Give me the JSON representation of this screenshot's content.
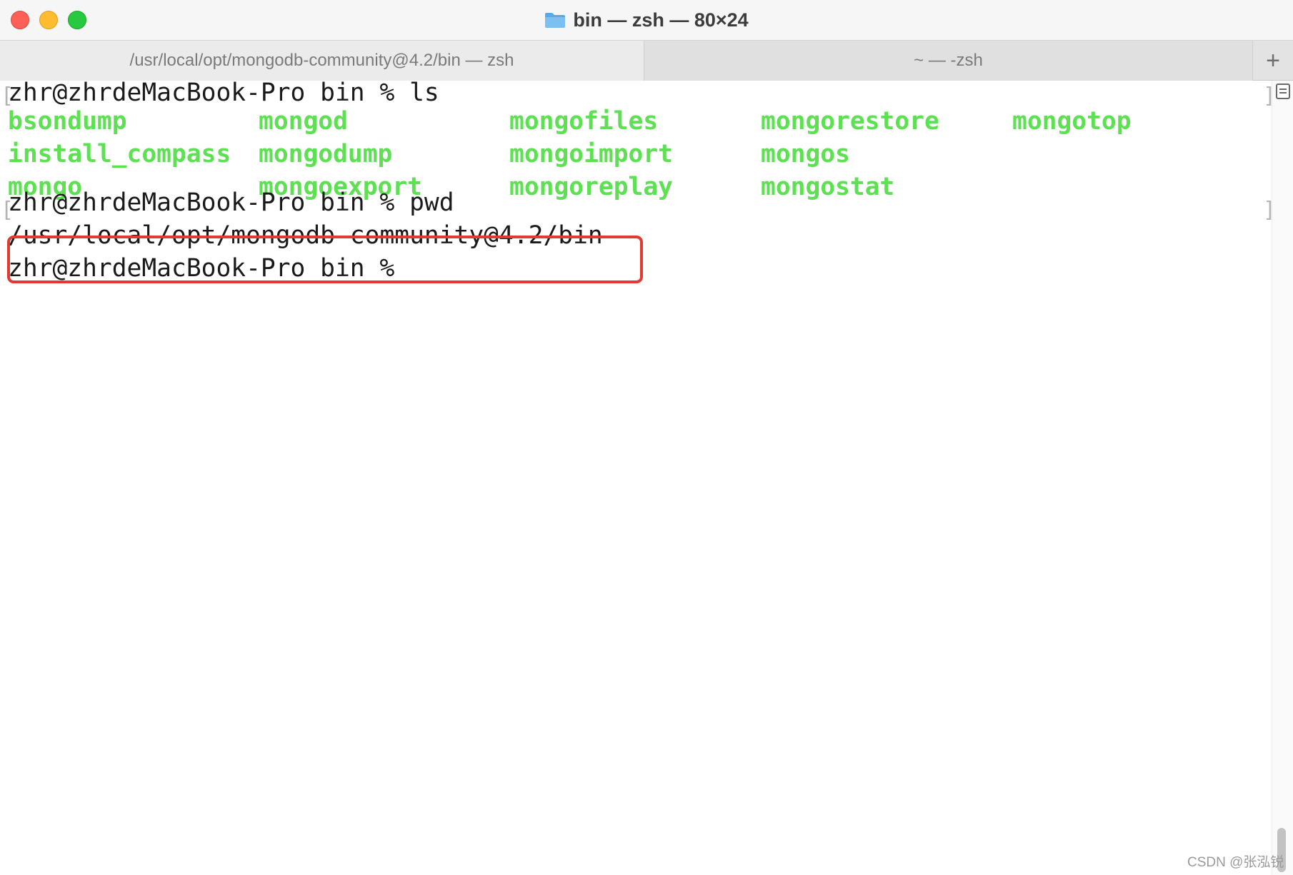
{
  "window": {
    "title": "bin — zsh — 80×24",
    "title_icon": "folder-icon"
  },
  "tabs": [
    {
      "label": "/usr/local/opt/mongodb-community@4.2/bin — zsh",
      "active": true
    },
    {
      "label": "~ — -zsh",
      "active": false
    }
  ],
  "new_tab_label": "+",
  "terminal": {
    "prompt_ls": "zhr@zhrdeMacBook-Pro bin % ls",
    "ls_output": [
      [
        "bsondump",
        "mongod",
        "mongofiles",
        "mongorestore",
        "mongotop"
      ],
      [
        "install_compass",
        "mongodump",
        "mongoimport",
        "mongos"
      ],
      [
        "mongo",
        "mongoexport",
        "mongoreplay",
        "mongostat"
      ]
    ],
    "prompt_pwd": "zhr@zhrdeMacBook-Pro bin % pwd",
    "pwd_output": "/usr/local/opt/mongodb-community@4.2/bin",
    "prompt_idle": "zhr@zhrdeMacBook-Pro bin %"
  },
  "colors": {
    "ls_executable": "#5ee053",
    "highlight_border": "#e03b2e"
  },
  "watermark": "CSDN @张泓锐"
}
